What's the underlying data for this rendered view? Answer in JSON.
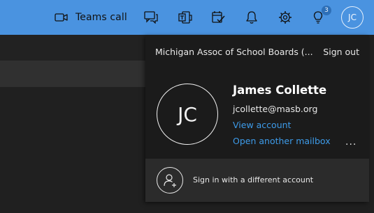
{
  "topbar": {
    "teams_call_label": "Teams call",
    "teams_call_icon": "video-camera-icon",
    "icons": [
      "chat-icon",
      "teams-icon",
      "todo-icon",
      "bell-icon",
      "gear-icon",
      "lightbulb-icon"
    ],
    "tips_badge": "3",
    "account_initials": "JC",
    "accent_color": "#4a93e0"
  },
  "account_panel": {
    "organization": "Michigan Assoc of School Boards (...",
    "sign_out": "Sign out",
    "initials": "JC",
    "name": "James Collette",
    "email": "jcollette@masb.org",
    "view_account": "View account",
    "open_another_mailbox": "Open another mailbox",
    "more_options": "...",
    "sign_in_different": "Sign in with a different account",
    "link_color": "#3d9be9"
  }
}
